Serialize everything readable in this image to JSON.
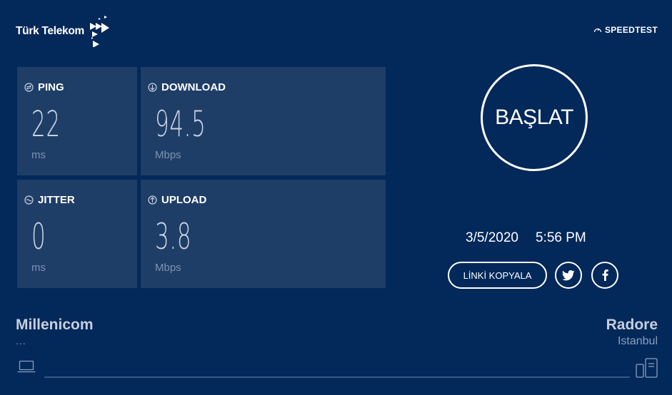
{
  "brand": {
    "logo_text": "Türk Telekom",
    "speedtest_label": "SPEEDTEST"
  },
  "metrics": {
    "ping": {
      "label": "PING",
      "value": "22",
      "unit": "ms"
    },
    "download": {
      "label": "DOWNLOAD",
      "value": "94.5",
      "unit": "Mbps"
    },
    "jitter": {
      "label": "JITTER",
      "value": "0",
      "unit": "ms"
    },
    "upload": {
      "label": "UPLOAD",
      "value": "3.8",
      "unit": "Mbps"
    }
  },
  "start_button": {
    "label": "BAŞLAT"
  },
  "result": {
    "date": "3/5/2020",
    "time": "5:56 PM"
  },
  "actions": {
    "copy_link_label": "LİNKİ KOPYALA",
    "twitter_icon": "twitter-icon",
    "facebook_icon": "facebook-icon"
  },
  "connection": {
    "isp_name": "Millenicom",
    "isp_sub": "...",
    "server_name": "Radore",
    "server_location": "Istanbul"
  },
  "colors": {
    "background": "#03285a",
    "card": "#1e3e67",
    "value_text": "#c9d3e2",
    "unit_text": "#7c93b3"
  }
}
